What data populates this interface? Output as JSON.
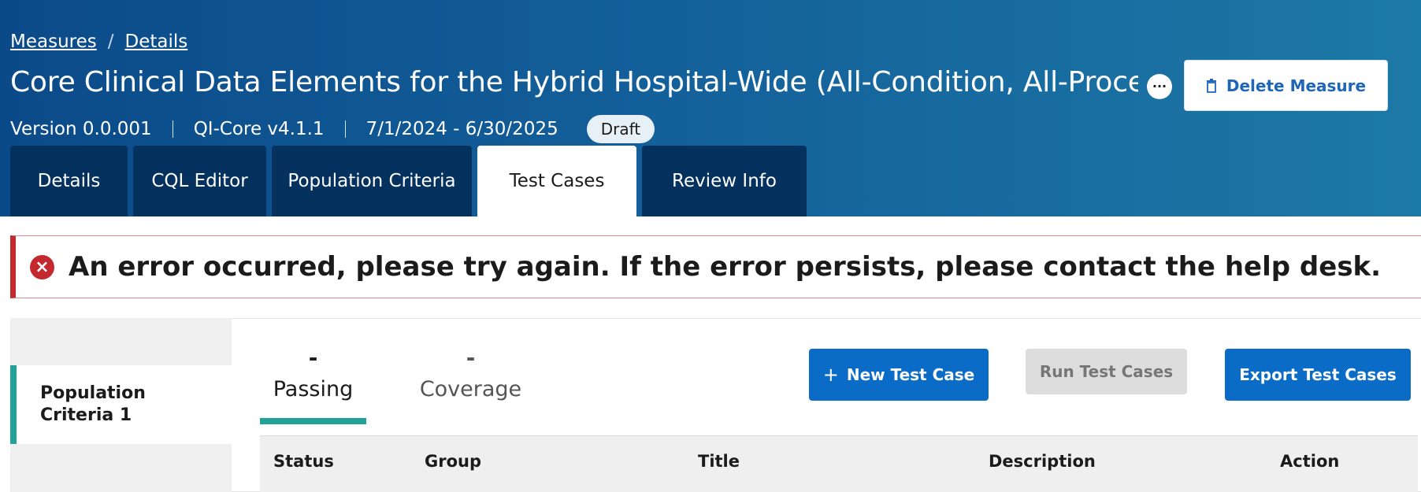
{
  "breadcrumb": {
    "measures": "Measures",
    "separator": "/",
    "details": "Details"
  },
  "header": {
    "title": "Core Clinical Data Elements for the Hybrid Hospital-Wide (All-Condition, All-Procedure",
    "more_label": "...",
    "delete_label": "Delete Measure",
    "delete_icon": "trash-icon",
    "version": "Version 0.0.001",
    "model": "QI-Core v4.1.1",
    "period": "7/1/2024 - 6/30/2025",
    "status": "Draft"
  },
  "tabs": [
    {
      "label": "Details",
      "active": false
    },
    {
      "label": "CQL Editor",
      "active": false
    },
    {
      "label": "Population Criteria",
      "active": false
    },
    {
      "label": "Test Cases",
      "active": true
    },
    {
      "label": "Review Info",
      "active": false
    }
  ],
  "error": {
    "icon": "error-icon",
    "message": "An error occurred, please try again. If the error persists, please contact the help desk."
  },
  "sidebar": {
    "items": [
      {
        "label": "Population Criteria 1",
        "active": true
      }
    ]
  },
  "stats": {
    "passing": {
      "value": "-",
      "label": "Passing"
    },
    "coverage": {
      "value": "-",
      "label": "Coverage"
    }
  },
  "actions": {
    "new_label": "New Test Case",
    "new_icon": "plus-icon",
    "run_label": "Run Test Cases",
    "export_label": "Export Test Cases"
  },
  "table": {
    "columns": [
      "Status",
      "Group",
      "Title",
      "Description",
      "Action"
    ]
  },
  "colors": {
    "header_start": "#0b4a89",
    "header_end": "#1d79a6",
    "primary": "#0b6cc8",
    "accent": "#23a29a",
    "error": "#c3292e"
  }
}
